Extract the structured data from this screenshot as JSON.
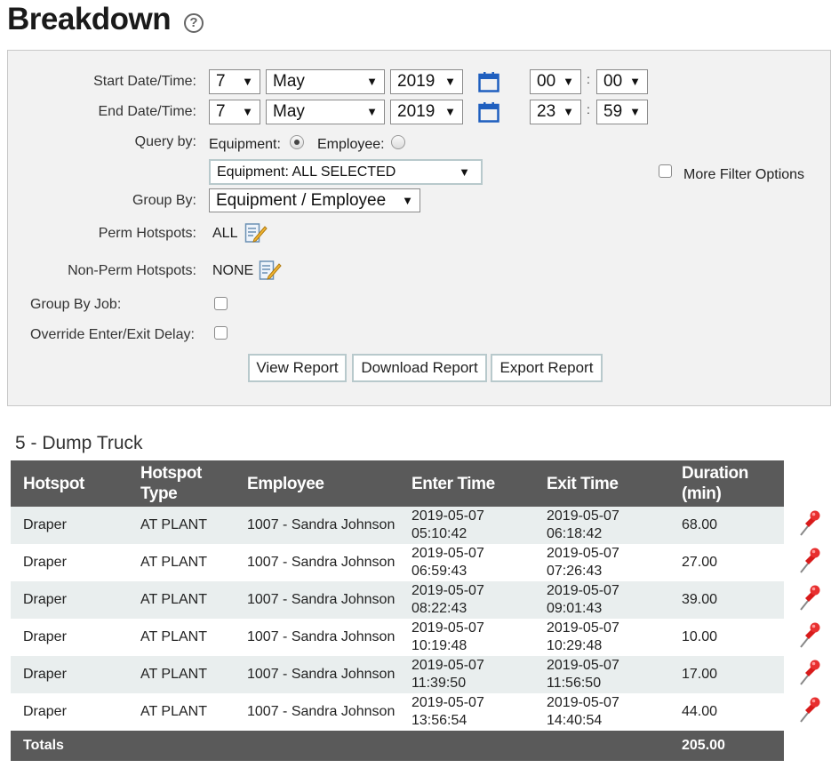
{
  "page": {
    "title": "Breakdown",
    "help_icon": "?"
  },
  "filters": {
    "start_label": "Start Date/Time:",
    "end_label": "End Date/Time:",
    "start": {
      "day": "7",
      "month": "May",
      "year": "2019",
      "hour": "00",
      "minute": "00"
    },
    "end": {
      "day": "7",
      "month": "May",
      "year": "2019",
      "hour": "23",
      "minute": "59"
    },
    "time_sep": ":",
    "query_by_label": "Query by:",
    "query_equipment_label": "Equipment:",
    "query_employee_label": "Employee:",
    "query_selected": "equipment",
    "equipment_select": "Equipment: ALL SELECTED",
    "more_filter_label": "More Filter Options",
    "group_by_label": "Group By:",
    "group_by_value": "Equipment / Employee",
    "perm_hotspots_label": "Perm Hotspots:",
    "perm_hotspots_value": "ALL",
    "nonperm_hotspots_label": "Non-Perm Hotspots:",
    "nonperm_hotspots_value": "NONE",
    "group_by_job_label": "Group By Job:",
    "override_label": "Override Enter/Exit Delay:"
  },
  "buttons": {
    "view": "View Report",
    "download": "Download Report",
    "export": "Export Report"
  },
  "report": {
    "group_title": "5 - Dump Truck",
    "columns": [
      "Hotspot",
      "Hotspot Type",
      "Employee",
      "Enter Time",
      "Exit Time",
      "Duration (min)"
    ],
    "rows": [
      {
        "hotspot": "Draper",
        "type": "AT PLANT",
        "employee": "1007 - Sandra Johnson",
        "enter": "2019-05-07 05:10:42",
        "exit": "2019-05-07 06:18:42",
        "duration": "68.00"
      },
      {
        "hotspot": "Draper",
        "type": "AT PLANT",
        "employee": "1007 - Sandra Johnson",
        "enter": "2019-05-07 06:59:43",
        "exit": "2019-05-07 07:26:43",
        "duration": "27.00"
      },
      {
        "hotspot": "Draper",
        "type": "AT PLANT",
        "employee": "1007 - Sandra Johnson",
        "enter": "2019-05-07 08:22:43",
        "exit": "2019-05-07 09:01:43",
        "duration": "39.00"
      },
      {
        "hotspot": "Draper",
        "type": "AT PLANT",
        "employee": "1007 - Sandra Johnson",
        "enter": "2019-05-07 10:19:48",
        "exit": "2019-05-07 10:29:48",
        "duration": "10.00"
      },
      {
        "hotspot": "Draper",
        "type": "AT PLANT",
        "employee": "1007 - Sandra Johnson",
        "enter": "2019-05-07 11:39:50",
        "exit": "2019-05-07 11:56:50",
        "duration": "17.00"
      },
      {
        "hotspot": "Draper",
        "type": "AT PLANT",
        "employee": "1007 - Sandra Johnson",
        "enter": "2019-05-07 13:56:54",
        "exit": "2019-05-07 14:40:54",
        "duration": "44.00"
      }
    ],
    "totals_label": "Totals",
    "totals_value": "205.00"
  },
  "colors": {
    "header_bg": "#5a5a5a",
    "row_alt_bg": "#e9eeee",
    "calendar_blue": "#1f5fbf",
    "pin_red": "#e02020"
  },
  "icons": {
    "calendar": "calendar-icon",
    "edit": "edit-list-icon",
    "pin": "pushpin-icon",
    "dropdown": "dropdown-arrow-icon"
  }
}
